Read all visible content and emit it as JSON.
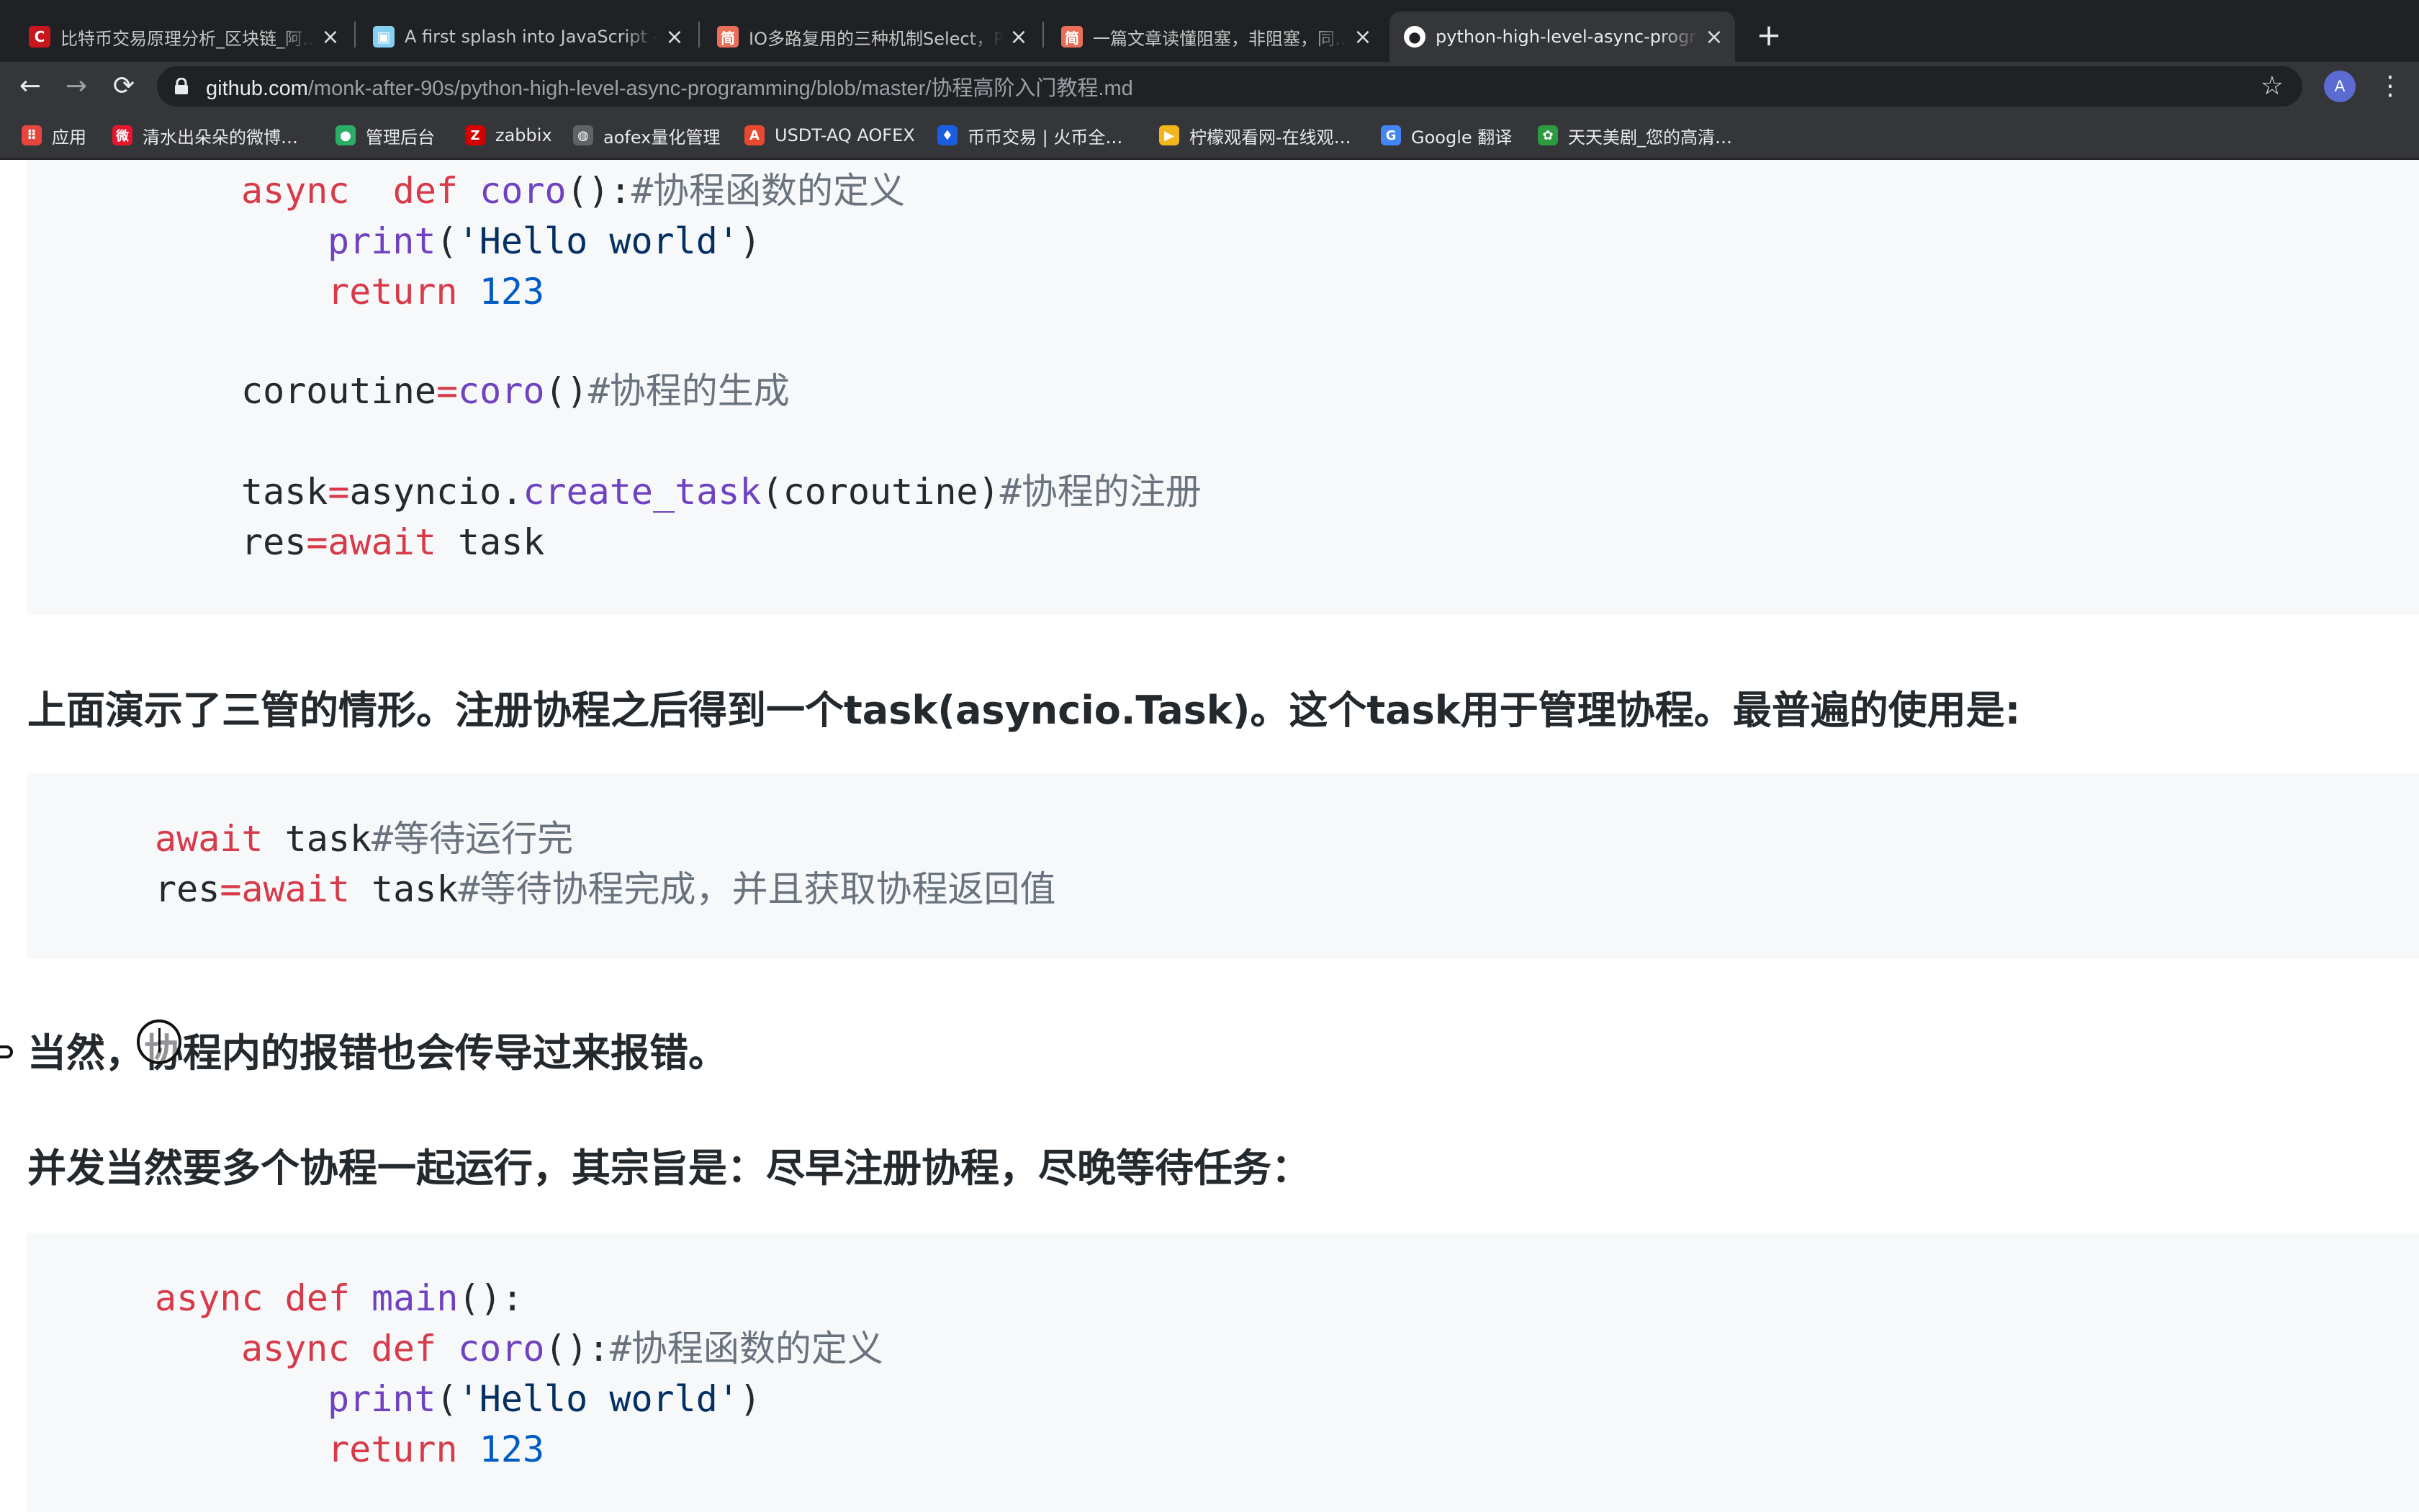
{
  "browser": {
    "tabs": [
      {
        "title": "比特币交易原理分析_区块链_阿…",
        "icon": "csdn-icon",
        "icon_color": "#c8161e",
        "icon_glyph": "C"
      },
      {
        "title": "A first splash into JavaScript - Le…",
        "icon": "mdn-icon",
        "icon_color": "#83d0f2",
        "icon_glyph": "▣"
      },
      {
        "title": "IO多路复用的三种机制Select，P…",
        "icon": "jianshu-icon",
        "icon_color": "#ea6f5a",
        "icon_glyph": "简"
      },
      {
        "title": "一篇文章读懂阻塞，非阻塞，同…",
        "icon": "jianshu-icon",
        "icon_color": "#ea6f5a",
        "icon_glyph": "简"
      },
      {
        "title": "python-high-level-async-progra…",
        "icon": "github-icon",
        "icon_color": "#ffffff",
        "icon_glyph": "●",
        "active": true
      }
    ],
    "new_tab_glyph": "+",
    "close_glyph": "×",
    "url_host": "github.com",
    "url_path": "/monk-after-90s/python-high-level-async-programming/blob/master/协程高阶入门教程.md",
    "avatar_letter": "A",
    "back_glyph": "←",
    "forward_glyph": "→",
    "reload_glyph": "⟳",
    "star_glyph": "☆",
    "menu_glyph": "⋮",
    "bookmarks": [
      {
        "label": "应用",
        "icon": "apps-grid-icon",
        "color": "#e8453c",
        "glyph": "⠿"
      },
      {
        "label": "清水出朵朵的微博…",
        "icon": "weibo-icon",
        "color": "#e6162d",
        "glyph": "微"
      },
      {
        "label": "管理后台",
        "icon": "wechat-icon",
        "color": "#2aae67",
        "glyph": "●"
      },
      {
        "label": "zabbix",
        "icon": "zabbix-icon",
        "color": "#d40000",
        "glyph": "Z"
      },
      {
        "label": "aofex量化管理",
        "icon": "globe-icon",
        "color": "#5f6368",
        "glyph": "◍"
      },
      {
        "label": "USDT-AQ AOFEX",
        "icon": "aofex-icon",
        "color": "#e84a2f",
        "glyph": "A"
      },
      {
        "label": "币币交易 | 火币全…",
        "icon": "huobi-icon",
        "color": "#1c5de0",
        "glyph": "♦"
      },
      {
        "label": "柠檬观看网-在线观…",
        "icon": "video-icon",
        "color": "#f2b51b",
        "glyph": "▶"
      },
      {
        "label": "Google 翻译",
        "icon": "google-translate-icon",
        "color": "#4285f4",
        "glyph": "G"
      },
      {
        "label": "天天美剧_您的高清…",
        "icon": "ttmj-icon",
        "color": "#2c9b3f",
        "glyph": "✿"
      }
    ]
  },
  "doc": {
    "code1": [
      {
        "tokens": [
          [
            "kw",
            "async"
          ],
          [
            "",
            "  "
          ],
          [
            "kw",
            "def"
          ],
          [
            "",
            " "
          ],
          [
            "fn",
            "coro"
          ],
          [
            "",
            "():"
          ],
          [
            "cm",
            "#协程函数的定义"
          ]
        ]
      },
      {
        "tokens": [
          [
            "fn",
            "print"
          ],
          [
            "",
            "("
          ],
          [
            "str",
            "'Hello world'"
          ],
          [
            "",
            ")"
          ]
        ]
      },
      {
        "tokens": [
          [
            "kw",
            "return"
          ],
          [
            "",
            " "
          ],
          [
            "num",
            "123"
          ]
        ]
      },
      {
        "tokens": [
          [
            "",
            "coroutine"
          ],
          [
            "op",
            "="
          ],
          [
            "fn",
            "coro"
          ],
          [
            "",
            "()"
          ],
          [
            "cm",
            "#协程的生成"
          ]
        ]
      },
      {
        "tokens": [
          [
            "",
            "task"
          ],
          [
            "op",
            "="
          ],
          [
            "",
            "asyncio."
          ],
          [
            "fn",
            "create_task"
          ],
          [
            "",
            "(coroutine)"
          ],
          [
            "cm",
            "#协程的注册"
          ]
        ]
      },
      {
        "tokens": [
          [
            "",
            "res"
          ],
          [
            "op",
            "="
          ],
          [
            "kw",
            "await"
          ],
          [
            "",
            " task"
          ]
        ]
      }
    ],
    "heading1": "上面演示了三管的情形。注册协程之后得到一个task(asyncio.Task)。这个task用于管理协程。最普遍的使用是:",
    "code2": [
      {
        "tokens": [
          [
            "kw",
            "await"
          ],
          [
            "",
            " task"
          ],
          [
            "cm",
            "#等待运行完"
          ]
        ]
      },
      {
        "tokens": [
          [
            "",
            "res"
          ],
          [
            "op",
            "="
          ],
          [
            "kw",
            "await"
          ],
          [
            "",
            " task"
          ],
          [
            "cm",
            "#等待协程完成，并且获取协程返回值"
          ]
        ]
      }
    ],
    "heading2": "当然，协程内的报错也会传导过来报错。",
    "heading3": "并发当然要多个协程一起运行，其宗旨是：尽早注册协程，尽晚等待任务：",
    "code3": [
      {
        "tokens": [
          [
            "kw",
            "async"
          ],
          [
            "",
            " "
          ],
          [
            "kw",
            "def"
          ],
          [
            "",
            " "
          ],
          [
            "fn",
            "main"
          ],
          [
            "",
            "():"
          ]
        ]
      },
      {
        "tokens": [
          [
            "kw",
            "async"
          ],
          [
            "",
            " "
          ],
          [
            "kw",
            "def"
          ],
          [
            "",
            " "
          ],
          [
            "fn",
            "coro"
          ],
          [
            "",
            "():"
          ],
          [
            "cm",
            "#协程函数的定义"
          ]
        ]
      },
      {
        "tokens": [
          [
            "fn",
            "print"
          ],
          [
            "",
            "("
          ],
          [
            "str",
            "'Hello world'"
          ],
          [
            "",
            ")"
          ]
        ]
      },
      {
        "tokens": [
          [
            "kw",
            "return"
          ],
          [
            "",
            " "
          ],
          [
            "num",
            "123"
          ]
        ]
      }
    ]
  }
}
